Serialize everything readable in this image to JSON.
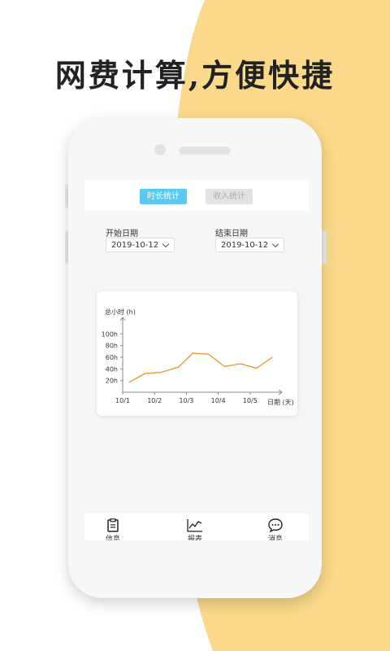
{
  "headline": "网费计算,方便快捷",
  "colors": {
    "accent_bg": "#fad98a",
    "active_tab": "#5bc8ef",
    "line": "#f0902a"
  },
  "tabs": [
    {
      "label": "时长统计",
      "active": true
    },
    {
      "label": "收入统计",
      "active": false
    }
  ],
  "start_date": {
    "label": "开始日期",
    "value": "2019-10-12"
  },
  "end_date": {
    "label": "结束日期",
    "value": "2019-10-12"
  },
  "chart_data": {
    "type": "line",
    "ylabel": "总小时 (h)",
    "xlabel": "日期 (天)",
    "y_ticks": [
      20,
      40,
      60,
      80,
      100
    ],
    "y_tick_labels": [
      "20h",
      "40h",
      "60h",
      "80h",
      "100h"
    ],
    "ylim": [
      0,
      120
    ],
    "x_tick_labels": [
      "10/1",
      "10/2",
      "10/3",
      "10/4",
      "10/5"
    ],
    "x_tick_positions": [
      0,
      2,
      4,
      6,
      8
    ],
    "xlim": [
      0,
      10
    ],
    "grid": false,
    "series": [
      {
        "x": [
          0.4,
          1.4,
          2.4,
          3.5,
          4.4,
          5.4,
          6.4,
          7.4,
          8.4,
          9.4
        ],
        "values": [
          17,
          32,
          34,
          43,
          67,
          65,
          44,
          49,
          41,
          60
        ]
      }
    ]
  },
  "nav": [
    {
      "label": "信息",
      "icon": "clipboard-icon"
    },
    {
      "label": "报表",
      "icon": "chart-icon"
    },
    {
      "label": "消息",
      "icon": "chat-icon"
    }
  ]
}
